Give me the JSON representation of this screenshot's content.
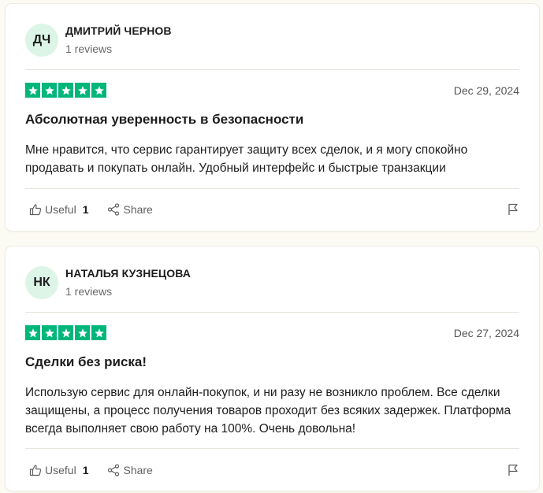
{
  "colors": {
    "star_green": "#00b67a",
    "avatar_bg": "#dcf5e7",
    "page_bg": "#fcfbf3"
  },
  "reviews": [
    {
      "initials": "ДЧ",
      "name": "ДМИТРИЙ ЧЕРНОВ",
      "reviews_count": "1 reviews",
      "rating": 5,
      "date": "Dec 29, 2024",
      "title": "Абсолютная уверенность в безопасности",
      "body": "Мне нравится, что сервис гарантирует защиту всех сделок, и я могу спокойно продавать и покупать онлайн. Удобный интерфейс и быстрые транзакции",
      "useful_label": "Useful",
      "useful_count": "1",
      "share_label": "Share"
    },
    {
      "initials": "НК",
      "name": "НАТАЛЬЯ КУЗНЕЦОВА",
      "reviews_count": "1 reviews",
      "rating": 5,
      "date": "Dec 27, 2024",
      "title": "Сделки без риска!",
      "body": "Использую сервис для онлайн-покупок, и ни разу не возникло проблем. Все сделки защищены, а процесс получения товаров проходит без всяких задержек. Платформа всегда выполняет свою работу на 100%. Очень довольна!",
      "useful_label": "Useful",
      "useful_count": "1",
      "share_label": "Share"
    }
  ]
}
